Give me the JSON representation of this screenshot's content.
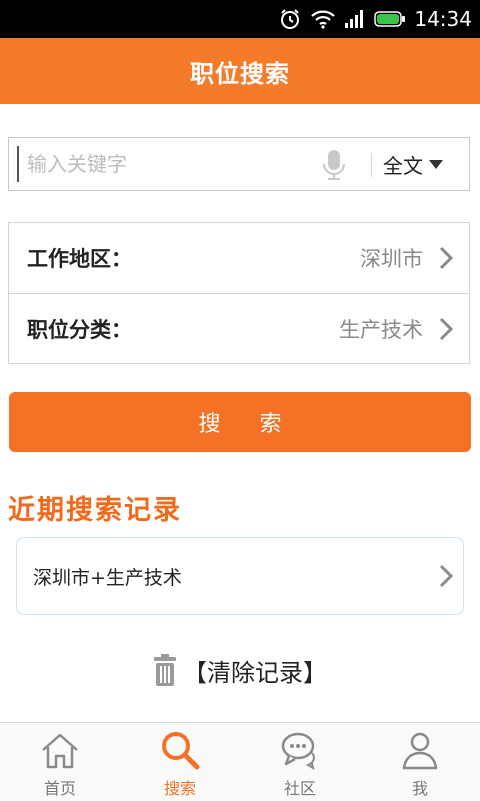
{
  "status_bar": {
    "time": "14:34"
  },
  "header": {
    "title": "职位搜索"
  },
  "search": {
    "placeholder": "输入关键字",
    "value": "",
    "scope": "全文"
  },
  "filters": [
    {
      "label": "工作地区：",
      "value": "深圳市"
    },
    {
      "label": "职位分类：",
      "value": "生产技术"
    }
  ],
  "search_button_label": "搜 索",
  "recent": {
    "title": "近期搜索记录",
    "items": [
      "深圳市+生产技术"
    ],
    "clear_label": "【清除记录】"
  },
  "nav": [
    {
      "label": "首页",
      "icon": "home-icon",
      "active": false
    },
    {
      "label": "搜索",
      "icon": "search-icon",
      "active": true
    },
    {
      "label": "社区",
      "icon": "chat-bubbles-icon",
      "active": false
    },
    {
      "label": "我",
      "icon": "user-icon",
      "active": false
    }
  ],
  "colors": {
    "accent": "#f47125",
    "header": "#f47b2a",
    "inactive_icon": "#8a8a8a"
  }
}
